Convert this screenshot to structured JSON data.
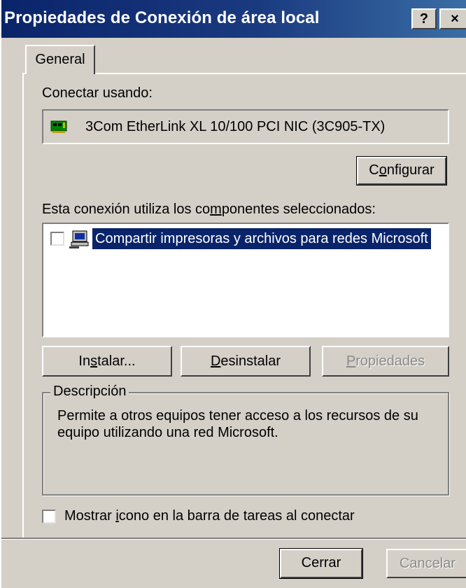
{
  "window": {
    "title": "Propiedades de Conexión de área local",
    "help_label": "?",
    "close_label": "×"
  },
  "tabs": [
    {
      "label": "General",
      "selected": true
    }
  ],
  "general": {
    "connect_using_label": "Conectar usando:",
    "adapter_name": "3Com EtherLink XL 10/100 PCI NIC (3C905-TX)",
    "configure_button": {
      "pre": "C",
      "hotkey": "o",
      "post": "nfigurar"
    },
    "components_label": {
      "pre": "Esta conexión utiliza los co",
      "hotkey": "m",
      "post": "ponentes seleccionados:"
    },
    "components": [
      {
        "label": "Compartir impresoras y archivos para redes Microsoft",
        "checked": false,
        "selected": true,
        "icon": "network-computer-icon"
      }
    ],
    "install_button": {
      "pre": "In",
      "hotkey": "s",
      "post": "talar..."
    },
    "uninstall_button": {
      "pre": "",
      "hotkey": "D",
      "post": "esinstalar"
    },
    "properties_button": {
      "pre": "",
      "hotkey": "P",
      "post": "ropiedades",
      "disabled": true
    },
    "description_title": "Descripción",
    "description_text": "Permite a otros equipos tener acceso a los recursos de su equipo utilizando una red Microsoft.",
    "show_icon_checkbox": {
      "pre": "Mostrar ",
      "hotkey": "i",
      "post": "cono en la barra de tareas al conectar",
      "checked": false
    }
  },
  "footer": {
    "close_button": "Cerrar",
    "cancel_button": {
      "label": "Cancelar",
      "disabled": true
    }
  },
  "colors": {
    "titlebar": "#0a246a",
    "face": "#d4d0c8",
    "selection": "#0a246a"
  }
}
